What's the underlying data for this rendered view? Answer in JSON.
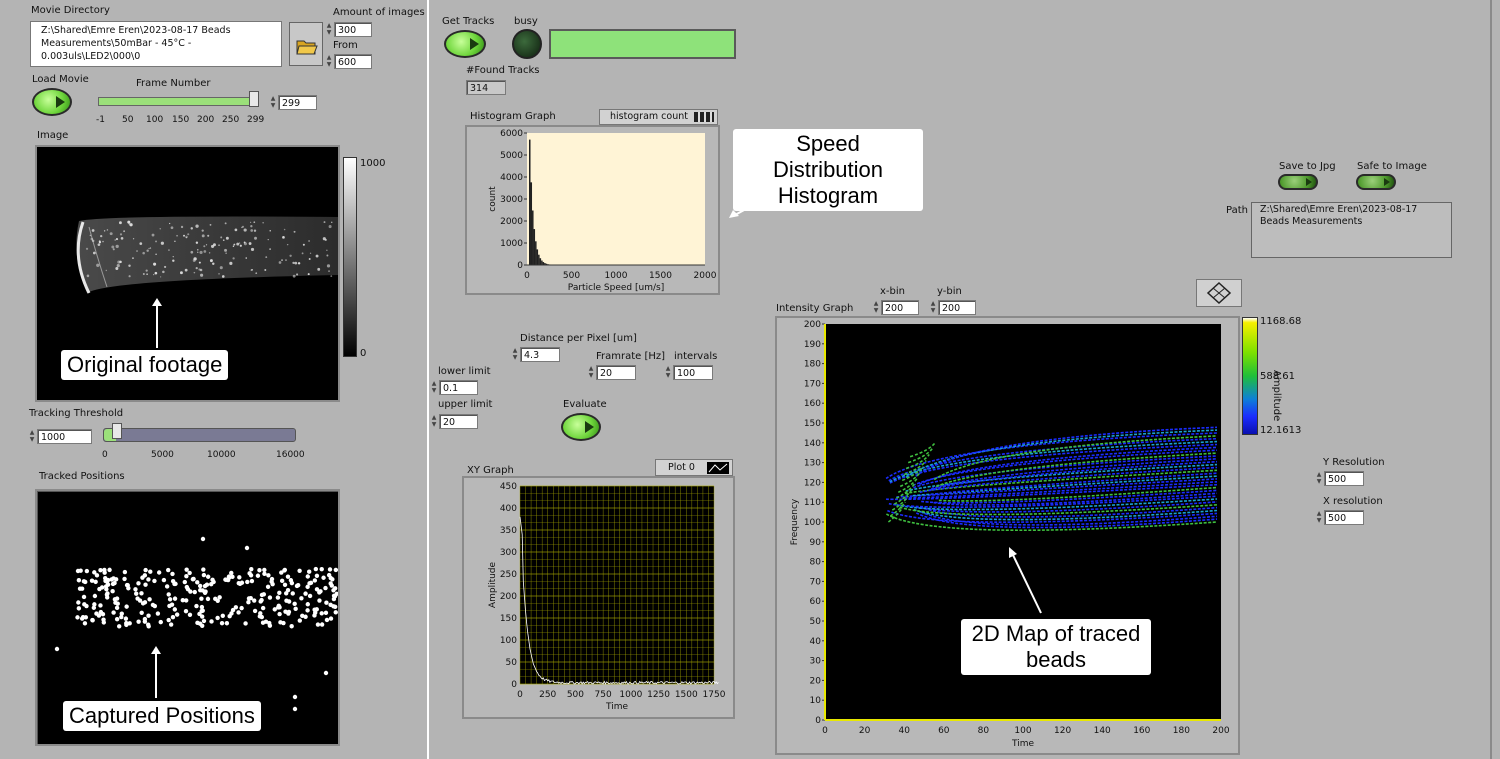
{
  "movie": {
    "dir_label": "Movie Directory",
    "dir_path": "Z:\\Shared\\Emre Eren\\2023-08-17 Beads Measurements\\50mBar - 45°C - 0.003uls\\LED2\\000\\0",
    "amount_label": "Amount of images",
    "amount_value": "300",
    "from_label": "From",
    "from_value": "600",
    "load_label": "Load Movie",
    "frame_label": "Frame Number",
    "frame_value": "299",
    "frame_ticks": [
      "-1",
      "50",
      "100",
      "150",
      "200",
      "250",
      "299"
    ],
    "frame_fraction": 1.0,
    "image_label": "Image",
    "colorbar_max": "1000",
    "colorbar_min": "0",
    "threshold_label": "Tracking Threshold",
    "threshold_value": "1000",
    "threshold_ticks": [
      "0",
      "5000",
      "10000",
      "16000"
    ],
    "threshold_fraction": 0.0625,
    "tracked_label": "Tracked Positions"
  },
  "tracks": {
    "get_label": "Get Tracks",
    "busy_label": "busy",
    "found_label": "#Found Tracks",
    "found_value": "314"
  },
  "histogram": {
    "title": "Histogram Graph",
    "legend": "histogram count",
    "ylabel": "count",
    "xlabel": "Particle Speed [um/s]",
    "yticks": [
      "6000",
      "5000",
      "4000",
      "3000",
      "2000",
      "1000",
      "0"
    ],
    "xticks": [
      "0",
      "500",
      "1000",
      "1500",
      "2000"
    ]
  },
  "params": {
    "dpp_label": "Distance per Pixel [um]",
    "dpp_value": "4.3",
    "lower_label": "lower limit",
    "lower_value": "0.1",
    "upper_label": "upper limit",
    "upper_value": "20",
    "framerate_label": "Framrate [Hz]",
    "framerate_value": "20",
    "intervals_label": "intervals",
    "intervals_value": "100",
    "evaluate_label": "Evaluate"
  },
  "xy": {
    "title": "XY Graph",
    "legend": "Plot 0",
    "ylabel": "Amplitude",
    "xlabel": "Time",
    "yticks": [
      "450",
      "400",
      "350",
      "300",
      "250",
      "200",
      "150",
      "100",
      "50",
      "0"
    ],
    "xticks": [
      "0",
      "250",
      "500",
      "750",
      "1000",
      "1250",
      "1500",
      "1750"
    ]
  },
  "intensity": {
    "title": "Intensity Graph",
    "xbin_label": "x-bin",
    "xbin_value": "200",
    "ybin_label": "y-bin",
    "ybin_value": "200",
    "ylabel": "Frequency",
    "xlabel": "Time",
    "yticks": [
      "200",
      "190",
      "180",
      "170",
      "160",
      "150",
      "140",
      "130",
      "120",
      "110",
      "100",
      "90",
      "80",
      "70",
      "60",
      "50",
      "40",
      "30",
      "20",
      "10",
      "0"
    ],
    "xticks": [
      "0",
      "20",
      "40",
      "60",
      "80",
      "100",
      "120",
      "140",
      "160",
      "180",
      "200"
    ],
    "cb_max": "1168.68",
    "cb_mid": "588.61",
    "cb_min": "12.1613",
    "cb_label": "Amplitude"
  },
  "export": {
    "save_jpg_label": "Save to Jpg",
    "safe_image_label": "Safe to Image",
    "path_label": "Path",
    "path_value": "Z:\\Shared\\Emre Eren\\2023-08-17 Beads Measurements",
    "yres_label": "Y Resolution",
    "yres_value": "500",
    "xres_label": "X resolution",
    "xres_value": "500"
  },
  "callouts": {
    "original": "Original footage",
    "captured": "Captured Positions",
    "speed": "Speed Distribution Histogram",
    "map": "2D Map of traced beads"
  },
  "colors": {
    "led_green": "#6fd63c",
    "busy_bar": "#8ee27a",
    "histogram_bg": "#fff4d6",
    "grid_yellow": "#a6a600",
    "map_blue": "#1a2cff",
    "map_green": "#3fbf3f"
  }
}
